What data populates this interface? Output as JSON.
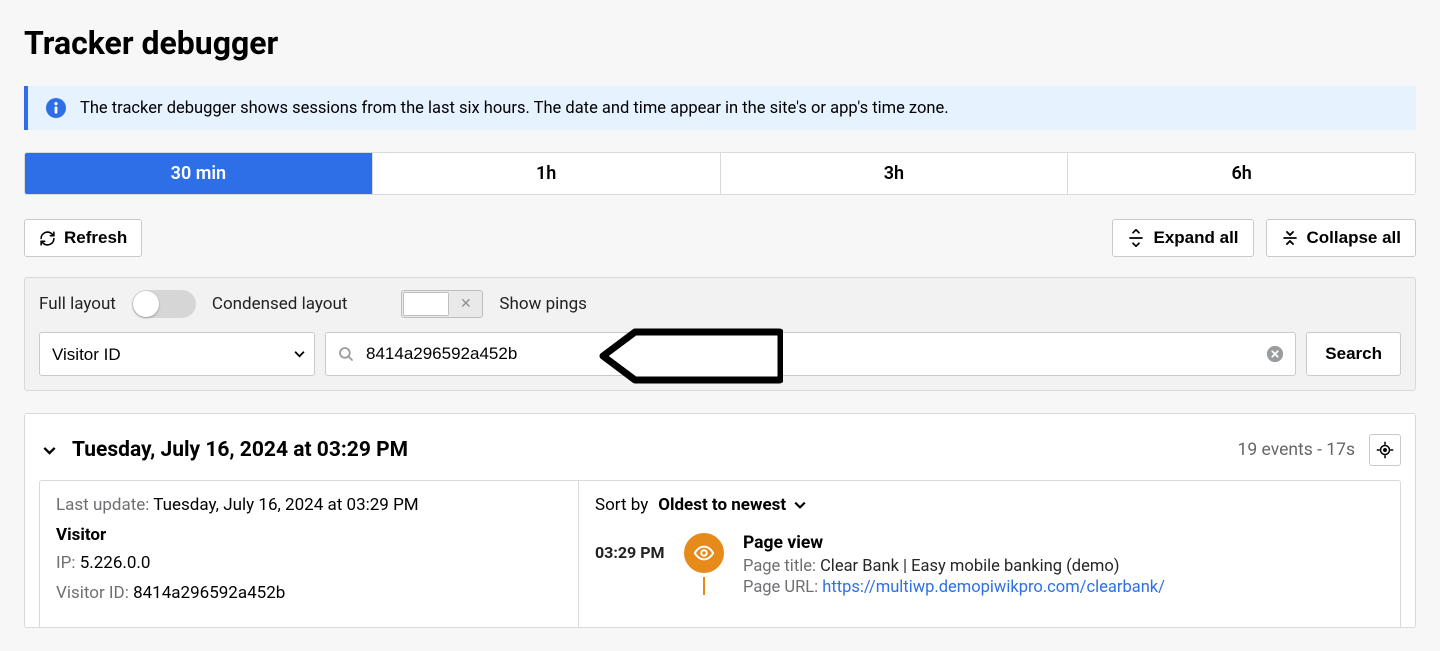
{
  "page": {
    "title": "Tracker debugger"
  },
  "banner": {
    "text": "The tracker debugger shows sessions from the last six hours. The date and time appear in the site's or app's time zone."
  },
  "timerange": {
    "tabs": [
      "30 min",
      "1h",
      "3h",
      "6h"
    ],
    "active_index": 0
  },
  "actions": {
    "refresh": "Refresh",
    "expand_all": "Expand all",
    "collapse_all": "Collapse all"
  },
  "filter": {
    "full_layout_label": "Full layout",
    "condensed_layout_label": "Condensed layout",
    "show_pings_label": "Show pings",
    "field_select_value": "Visitor ID",
    "search_value": "8414a296592a452b",
    "search_button": "Search"
  },
  "session": {
    "heading": "Tuesday, July 16, 2024 at 03:29 PM",
    "events_label": "19 events - 17s",
    "last_update_label": "Last update: ",
    "last_update_value": "Tuesday, July 16, 2024 at 03:29 PM",
    "visitor_section": "Visitor",
    "ip_label": "IP: ",
    "ip_value": "5.226.0.0",
    "visitor_id_label": "Visitor ID: ",
    "visitor_id_value": "8414a296592a452b",
    "sort_label": "Sort by",
    "sort_value": "Oldest to newest",
    "event": {
      "time": "03:29 PM",
      "title": "Page view",
      "page_title_label": "Page title: ",
      "page_title_value": "Clear Bank | Easy mobile banking (demo)",
      "page_url_label": "Page URL: ",
      "page_url_value": "https://multiwp.demopiwikpro.com/clearbank/"
    }
  }
}
